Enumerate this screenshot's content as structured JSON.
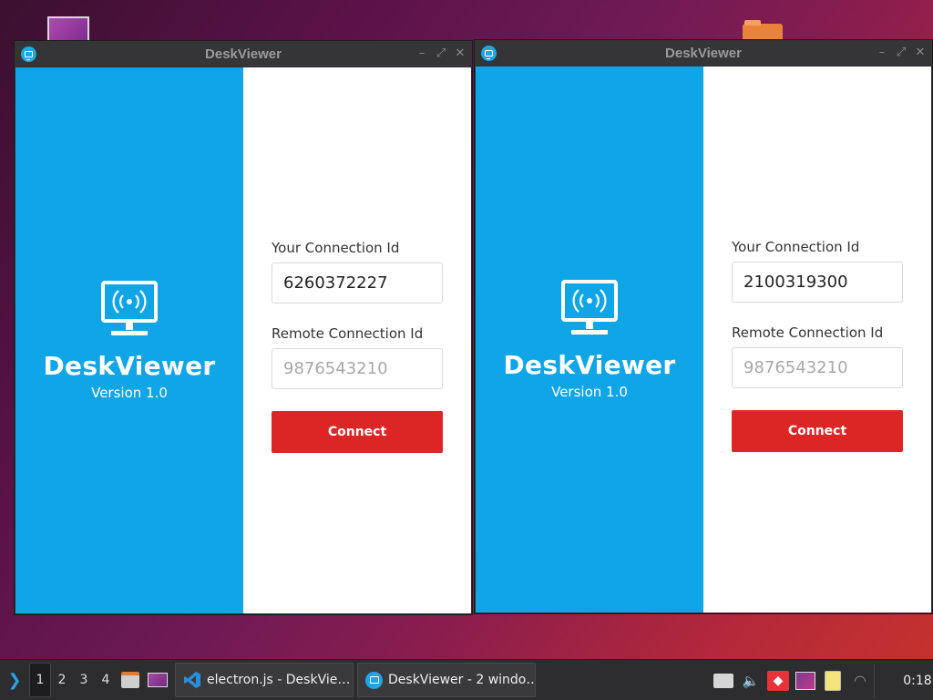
{
  "windows": [
    {
      "title": "DeskViewer",
      "brand_name": "DeskViewer",
      "version": "Version 1.0",
      "your_id_label": "Your Connection Id",
      "your_id_value": "6260372227",
      "remote_id_label": "Remote Connection Id",
      "remote_id_placeholder": "9876543210",
      "connect_label": "Connect"
    },
    {
      "title": "DeskViewer",
      "brand_name": "DeskViewer",
      "version": "Version 1.0",
      "your_id_label": "Your Connection Id",
      "your_id_value": "2100319300",
      "remote_id_label": "Remote Connection Id",
      "remote_id_placeholder": "9876543210",
      "connect_label": "Connect"
    }
  ],
  "window_controls": {
    "minimize": "–",
    "maximize": "⤢",
    "close": "✕"
  },
  "colors": {
    "brand_blue": "#10a5e6",
    "connect_red": "#dc2626"
  },
  "taskbar": {
    "workspaces": [
      "1",
      "2",
      "3",
      "4"
    ],
    "active_workspace": "1",
    "tasks": [
      {
        "label": "electron.js - DeskVie…",
        "icon": "vscode-icon"
      },
      {
        "label": "DeskViewer - 2 windo…",
        "icon": "deskviewer-icon"
      }
    ],
    "clock": "0:18"
  }
}
